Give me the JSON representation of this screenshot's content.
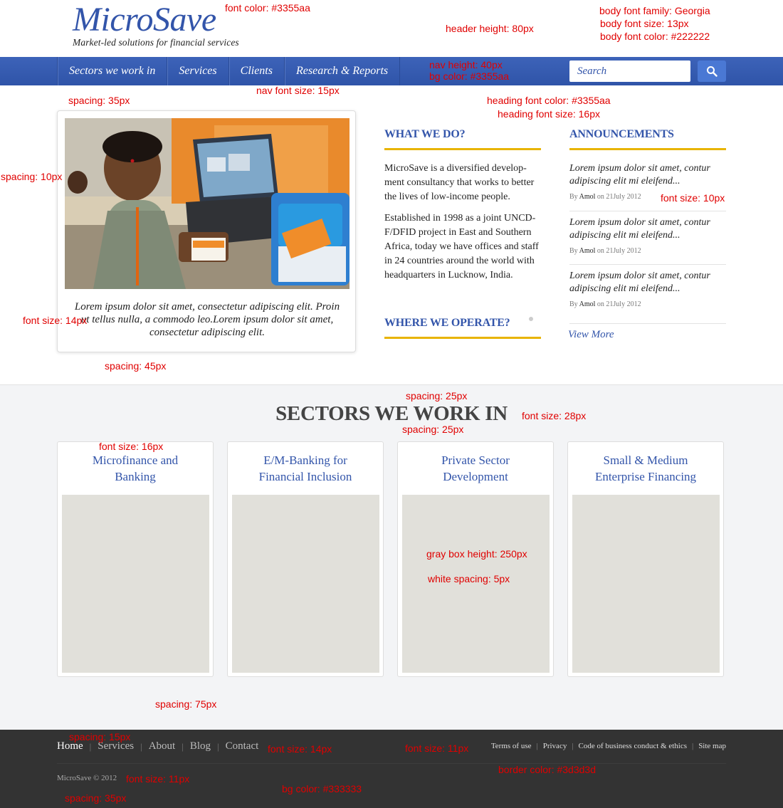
{
  "header": {
    "logo": "MicroSave",
    "tagline": "Market-led solutions for financial services"
  },
  "nav": {
    "items": [
      "Sectors we work in",
      "Services",
      "Clients",
      "Research & Reports"
    ],
    "search_placeholder": "Search",
    "search_icon": "search-icon"
  },
  "feature": {
    "caption": "Lorem ipsum dolor sit amet, consectetur adipiscing elit. Proin ut tellus nulla, a commodo leo.Lorem ipsum dolor sit amet, consectetur adipiscing elit."
  },
  "what_we_do": {
    "heading": "WHAT WE DO?",
    "para1": "MicroSave is a diversified develop-ment consultancy that works to better the lives of low-income people.",
    "para2": "Established in 1998  as a joint UNCD-F/DFID project in East and Southern Africa, today we have offices and staff in 24 countries around the world with headquarters in Lucknow, India."
  },
  "where_we_operate": {
    "heading": "WHERE WE OPERATE?"
  },
  "announcements": {
    "heading": "ANNOUNCEMENTS",
    "items": [
      {
        "title": "Lorem ipsum dolor sit amet, contur adipiscing elit mi eleifend...",
        "by": "By",
        "author": "Amol",
        "date": "on 21July 2012"
      },
      {
        "title": "Lorem ipsum dolor sit amet, contur adipiscing elit mi eleifend...",
        "by": "By",
        "author": "Amol",
        "date": "on 21July 2012"
      },
      {
        "title": "Lorem ipsum dolor sit amet, contur adipiscing elit mi eleifend...",
        "by": "By",
        "author": "Amol",
        "date": "on 21July 2012"
      }
    ],
    "view_more": "View More"
  },
  "sectors": {
    "title": "SECTORS WE WORK IN",
    "cards": [
      {
        "line1": "Microfinance and",
        "line2": "Banking"
      },
      {
        "line1": "E/M-Banking for",
        "line2": "Financial Inclusion"
      },
      {
        "line1": "Private Sector",
        "line2": "Development"
      },
      {
        "line1": "Small & Medium",
        "line2": "Enterprise Financing"
      }
    ]
  },
  "footer": {
    "links": [
      "Home",
      "Services",
      "About",
      "Blog",
      "Contact"
    ],
    "small_links": [
      "Terms of use",
      "Privacy",
      "Code of business conduct & ethics",
      "Site map"
    ],
    "copyright": "MicroSave © 2012"
  },
  "annotations": {
    "font_color": "font color: #3355aa",
    "body_font_family": "body font family: Georgia",
    "body_font_size": "body font size: 13px",
    "body_font_color": "body font color: #222222",
    "header_height": "header height: 80px",
    "nav_height": "nav height: 40px",
    "bg_color_nav": "bg color: #3355aa",
    "nav_font_size": "nav font size: 15px",
    "spacing_35_top": "spacing: 35px",
    "spacing_10": "spacing: 10px",
    "font_size_14_caption": "font size: 14px",
    "spacing_45": "spacing: 45px",
    "heading_font_color": "heading font color: #3355aa",
    "heading_font_size": "heading font size: 16px",
    "font_size_10": "font size: 10px",
    "spacing_25_a": "spacing: 25px",
    "font_size_28": "font size: 28px",
    "spacing_25_b": "spacing: 25px",
    "font_size_16": "font size: 16px",
    "gray_box_height": "gray box height: 250px",
    "white_spacing": "white spacing: 5px",
    "spacing_75": "spacing: 75px",
    "spacing_15": "spacing: 15px",
    "font_size_14_footer": "font size: 14px",
    "font_size_11_right": "font size: 11px",
    "border_color": "border color: #3d3d3d",
    "font_size_11_left": "font size: 11px",
    "bg_color_footer": "bg color: #333333",
    "spacing_35_bottom": "spacing: 35px"
  },
  "colors": {
    "brand": "#3355aa",
    "rule": "#e8b400",
    "footer_bg": "#333333",
    "gray_box": "#e1e0da"
  }
}
